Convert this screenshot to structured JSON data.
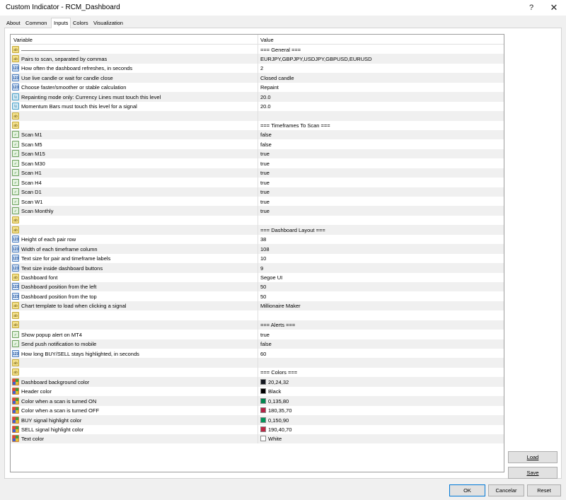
{
  "window": {
    "title": "Custom Indicator - RCM_Dashboard",
    "help_glyph": "?",
    "close_glyph": "✕"
  },
  "tabs": [
    "About",
    "Common",
    "Inputs",
    "Colors",
    "Visualization"
  ],
  "active_tab": "Inputs",
  "grid": {
    "headers": {
      "variable": "Variable",
      "value": "Value"
    },
    "rows": [
      {
        "icon": "ab",
        "label": "———————————",
        "value": "=== General ==="
      },
      {
        "icon": "ab",
        "label": "Pairs to scan, separated by commas",
        "value": "EURJPY,GBPJPY,USDJPY,GBPUSD,EURUSD"
      },
      {
        "icon": "123",
        "label": "How often the dashboard refreshes, in seconds",
        "value": "2"
      },
      {
        "icon": "123",
        "label": "Use live candle or wait for candle close",
        "value": "Closed candle"
      },
      {
        "icon": "123",
        "label": "Choose faster/smoother or stable calculation",
        "value": "Repaint"
      },
      {
        "icon": "v12",
        "label": "Repainting mode only: Currency Lines must touch this level",
        "value": "20.0"
      },
      {
        "icon": "v12",
        "label": "Momentum Bars must touch this level for a signal",
        "value": "20.0"
      },
      {
        "icon": "ab",
        "label": "",
        "value": ""
      },
      {
        "icon": "ab",
        "label": "",
        "value": "=== Timeframes To Scan ==="
      },
      {
        "icon": "chk",
        "label": "Scan M1",
        "value": "false"
      },
      {
        "icon": "chk",
        "label": "Scan M5",
        "value": "false"
      },
      {
        "icon": "chk",
        "label": "Scan M15",
        "value": "true"
      },
      {
        "icon": "chk",
        "label": "Scan M30",
        "value": "true"
      },
      {
        "icon": "chk",
        "label": "Scan H1",
        "value": "true"
      },
      {
        "icon": "chk",
        "label": "Scan H4",
        "value": "true"
      },
      {
        "icon": "chk",
        "label": "Scan D1",
        "value": "true"
      },
      {
        "icon": "chk",
        "label": "Scan W1",
        "value": "true"
      },
      {
        "icon": "chk",
        "label": "Scan Monthly",
        "value": "true"
      },
      {
        "icon": "ab",
        "label": "",
        "value": ""
      },
      {
        "icon": "ab",
        "label": "",
        "value": "=== Dashboard Layout ==="
      },
      {
        "icon": "123",
        "label": "Height of each pair row",
        "value": "38"
      },
      {
        "icon": "123",
        "label": "Width of each timeframe column",
        "value": "108"
      },
      {
        "icon": "123",
        "label": "Text size for pair and timeframe labels",
        "value": "10"
      },
      {
        "icon": "123",
        "label": "Text size inside dashboard buttons",
        "value": "9"
      },
      {
        "icon": "ab",
        "label": "Dashboard font",
        "value": "Segoe UI"
      },
      {
        "icon": "123",
        "label": "Dashboard position from the left",
        "value": "50"
      },
      {
        "icon": "123",
        "label": "Dashboard position from the top",
        "value": "50"
      },
      {
        "icon": "ab",
        "label": "Chart template to load when clicking a signal",
        "value": "Millionaire Maker"
      },
      {
        "icon": "ab",
        "label": "",
        "value": ""
      },
      {
        "icon": "ab",
        "label": "",
        "value": "=== Alerts ==="
      },
      {
        "icon": "chk",
        "label": "Show popup alert on MT4",
        "value": "true"
      },
      {
        "icon": "chk",
        "label": "Send push notification to mobile",
        "value": "false"
      },
      {
        "icon": "123",
        "label": "How long BUY/SELL stays highlighted, in seconds",
        "value": "60"
      },
      {
        "icon": "ab",
        "label": "",
        "value": ""
      },
      {
        "icon": "ab",
        "label": "",
        "value": "=== Colors ==="
      },
      {
        "icon": "clr",
        "label": "Dashboard background color",
        "value": "20,24,32",
        "swatch": "#141820"
      },
      {
        "icon": "clr",
        "label": "Header color",
        "value": "Black",
        "swatch": "#000000"
      },
      {
        "icon": "clr",
        "label": "Color when a scan is turned ON",
        "value": "0,135,80",
        "swatch": "#008750"
      },
      {
        "icon": "clr",
        "label": "Color when a scan is turned OFF",
        "value": "180,35,70",
        "swatch": "#b42346"
      },
      {
        "icon": "clr",
        "label": "BUY signal highlight color",
        "value": "0,150,90",
        "swatch": "#00965a"
      },
      {
        "icon": "clr",
        "label": "SELL signal highlight color",
        "value": "190,40,70",
        "swatch": "#be2846"
      },
      {
        "icon": "clr",
        "label": "Text color",
        "value": "White",
        "swatch": "#ffffff"
      }
    ]
  },
  "buttons": {
    "load": "Load",
    "save": "Save",
    "ok": "OK",
    "cancel": "Cancelar",
    "reset": "Reset"
  },
  "colors": {
    "ok_border": "#0078d7"
  }
}
